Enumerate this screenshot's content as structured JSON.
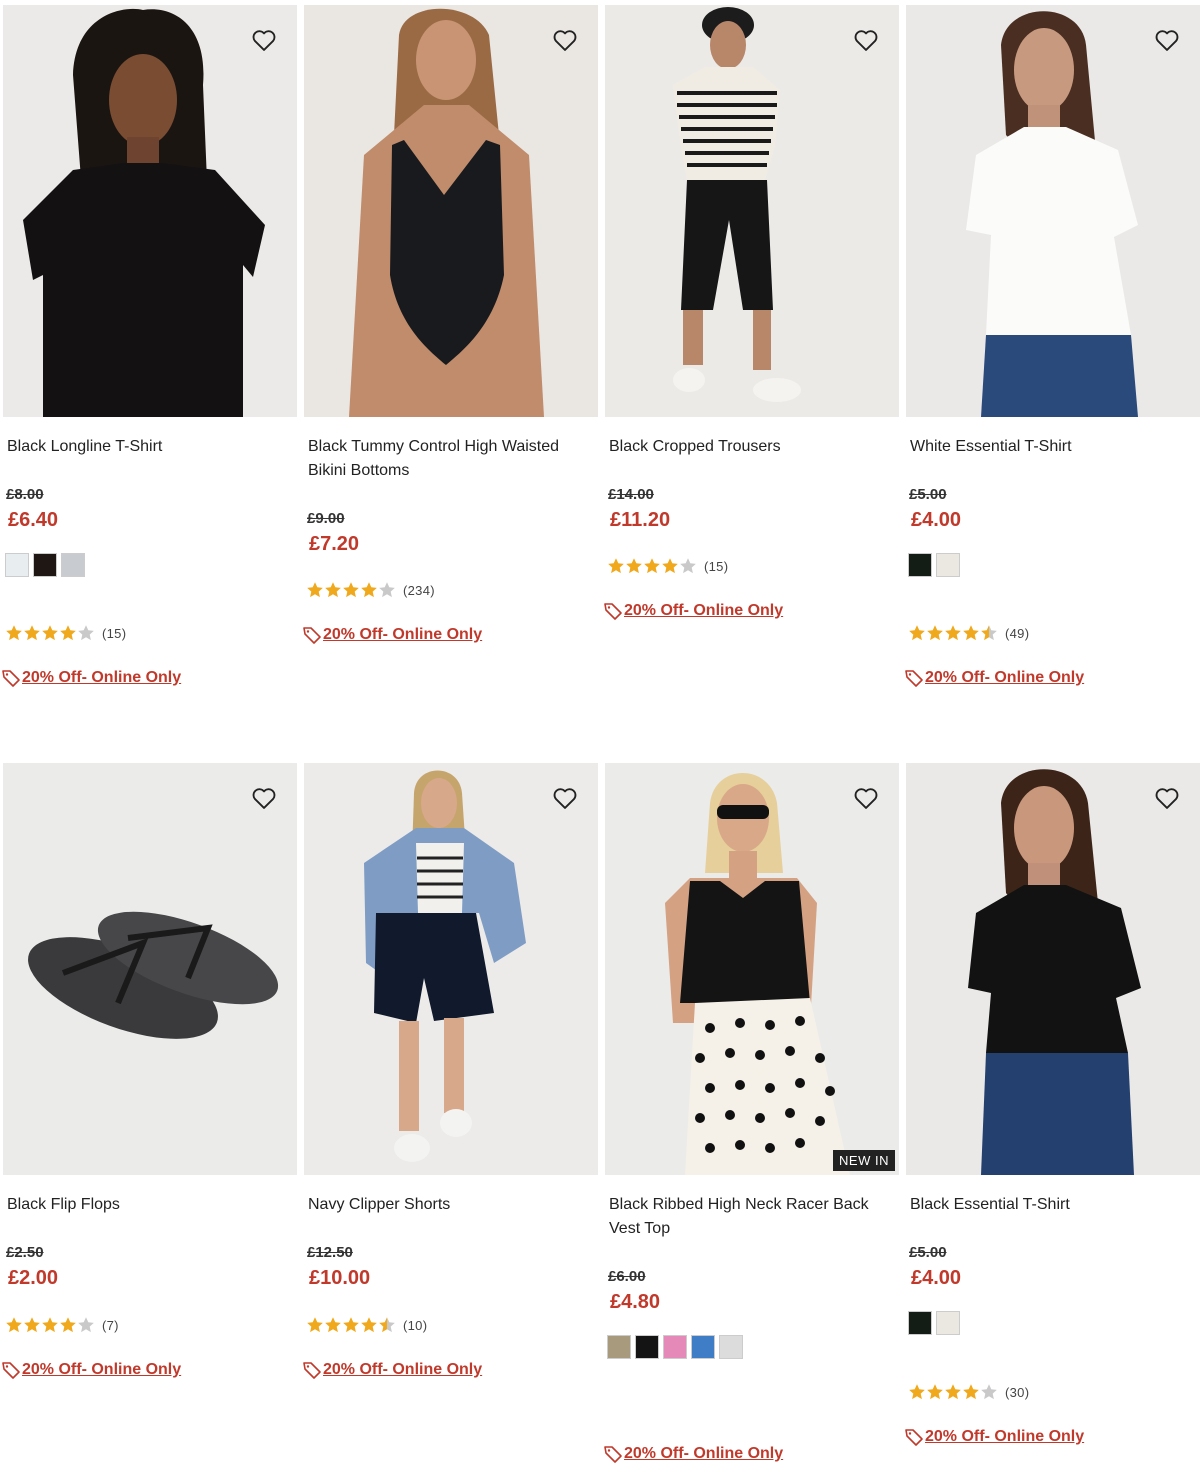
{
  "accent": "#c0392b",
  "promo_label": "20% Off- Online Only",
  "products": [
    {
      "title": "Black Longline T-Shirt",
      "was_price": "£8.00",
      "price": "£6.40",
      "image_icon": "black-tshirt-model-photo",
      "swatches": [
        "#e8edf0",
        "#1e1714",
        "#c8ccd0"
      ],
      "rating": 4,
      "review_count": "(15)",
      "badge": ""
    },
    {
      "title": "Black Tummy Control High Waisted Bikini Bottoms",
      "was_price": "£9.00",
      "price": "£7.20",
      "image_icon": "black-swimsuit-model-photo",
      "swatches": [],
      "rating": 4,
      "review_count": "(234)",
      "badge": ""
    },
    {
      "title": "Black Cropped Trousers",
      "was_price": "£14.00",
      "price": "£11.20",
      "image_icon": "cropped-trousers-model-photo",
      "swatches": [],
      "rating": 4,
      "review_count": "(15)",
      "badge": ""
    },
    {
      "title": "White Essential T-Shirt",
      "was_price": "£5.00",
      "price": "£4.00",
      "image_icon": "white-tshirt-model-photo",
      "swatches": [
        "#141c16",
        "#ebe8e2"
      ],
      "rating": 4.5,
      "review_count": "(49)",
      "badge": ""
    },
    {
      "title": "Black Flip Flops",
      "was_price": "£2.50",
      "price": "£2.00",
      "image_icon": "flip-flops-photo",
      "swatches": [],
      "rating": 4,
      "review_count": "(7)",
      "badge": ""
    },
    {
      "title": "Navy Clipper Shorts",
      "was_price": "£12.50",
      "price": "£10.00",
      "image_icon": "navy-shorts-model-photo",
      "swatches": [],
      "rating": 4.5,
      "review_count": "(10)",
      "badge": ""
    },
    {
      "title": "Black Ribbed High Neck Racer Back Vest Top",
      "was_price": "£6.00",
      "price": "£4.80",
      "image_icon": "black-vest-model-photo",
      "swatches": [
        "#a89a7c",
        "#141414",
        "#e58ab8",
        "#3f7ec6",
        "#dcdcdc"
      ],
      "rating": null,
      "review_count": "",
      "badge": "NEW IN"
    },
    {
      "title": "Black Essential T-Shirt",
      "was_price": "£5.00",
      "price": "£4.00",
      "image_icon": "black-essential-tshirt-model-photo",
      "swatches": [
        "#141c16",
        "#ebe8e2"
      ],
      "rating": 4,
      "review_count": "(30)",
      "badge": ""
    }
  ]
}
